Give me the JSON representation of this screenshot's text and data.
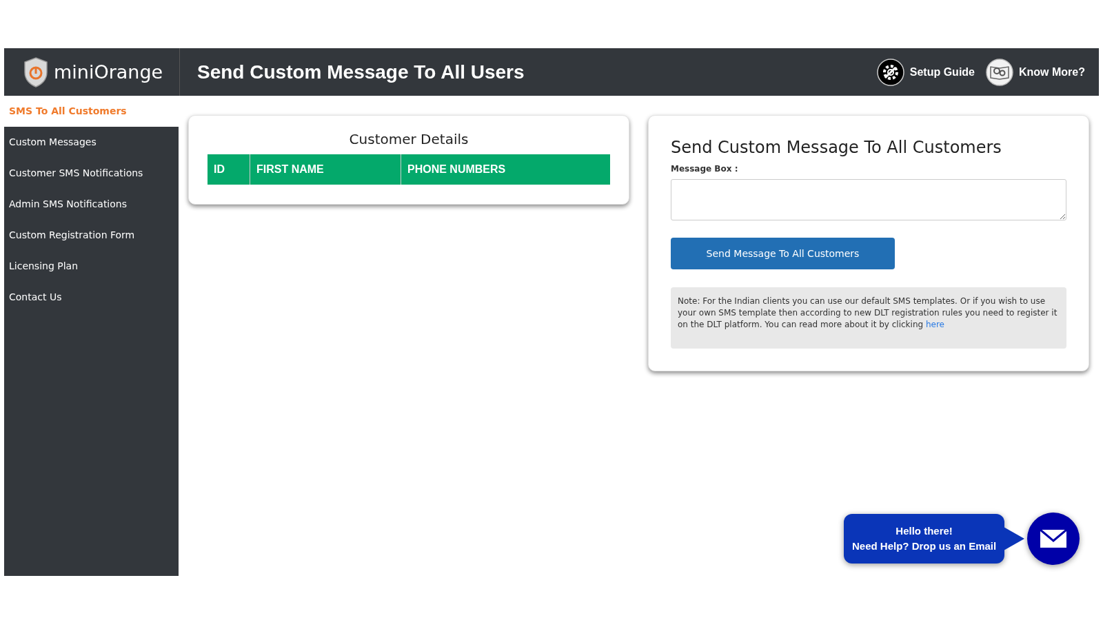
{
  "brand": {
    "name": "miniOrange"
  },
  "header": {
    "title": "Send Custom Message To All Users",
    "links": [
      {
        "kind": "gear",
        "label": "Setup Guide"
      },
      {
        "kind": "book",
        "label": "Know More?"
      }
    ]
  },
  "sidebar": {
    "items": [
      {
        "label": "SMS To All Customers",
        "selected": true
      },
      {
        "label": "Custom Messages",
        "selected": false
      },
      {
        "label": "Customer SMS Notifications",
        "selected": false
      },
      {
        "label": "Admin SMS Notifications",
        "selected": false
      },
      {
        "label": "Custom Registration Form",
        "selected": false
      },
      {
        "label": "Licensing Plan",
        "selected": false
      },
      {
        "label": "Contact Us",
        "selected": false
      }
    ]
  },
  "customer_details": {
    "title": "Customer Details",
    "columns": [
      "ID",
      "FIRST NAME",
      "PHONE NUMBERS"
    ]
  },
  "message_form": {
    "title": "Send Custom Message To All Customers",
    "field_label": "Message Box :",
    "button": "Send Message To All Customers",
    "note": {
      "text": "Note: For the Indian clients you can use our default SMS templates. Or if you wish to use your own SMS template then according to new DLT registration rules you need to register it on the DLT platform. You can read more about it by clicking ",
      "link": "here"
    }
  },
  "help": {
    "lines": [
      "Hello there!",
      "Need Help? Drop us an Email"
    ]
  }
}
